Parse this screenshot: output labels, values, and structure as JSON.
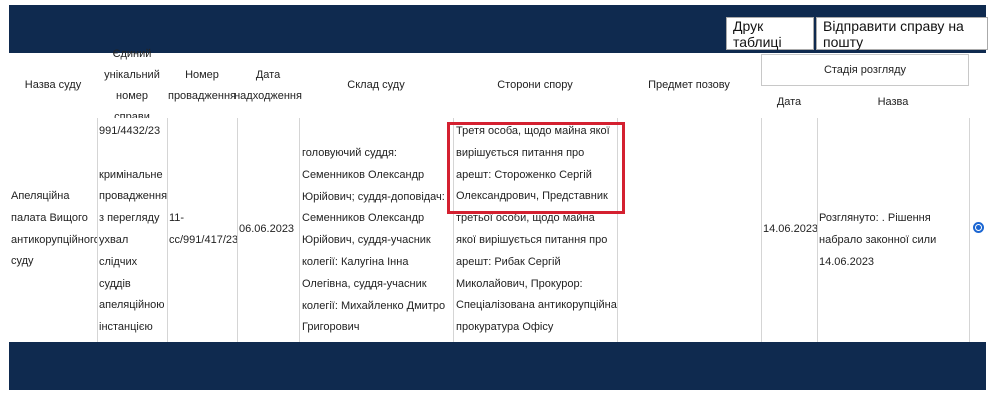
{
  "toolbar": {
    "print_label": "Друк таблиці",
    "mail_label": "Відправити справу на пошту"
  },
  "table": {
    "headers": {
      "court": "Назва суду",
      "unique_number": "Єдиний унікальний номер справи",
      "proceeding_number": "Номер провадження",
      "received_date": "Дата надходження",
      "panel": "Склад суду",
      "parties": "Сторони спору",
      "subject": "Предмет позову",
      "stage": "Стадія розгляду",
      "stage_date": "Дата",
      "stage_name": "Назва"
    },
    "row": {
      "court": "Апеляційна палата Вищого антикорупційного суду",
      "unique_number": "991/4432/23",
      "case_category": "кримінальне провадження з перегляду ухвал слідчих суддів апеляційною інстанцією",
      "proceeding_number": "11-cc/991/417/23",
      "received_date": "06.06.2023",
      "panel": "головуючий суддя: Семенников Олександр Юрійович; суддя-доповідач: Семенников Олександр Юрійович, суддя-учасник колегії: Калугіна Інна Олегівна, суддя-учасник колегії: Михайленко Дмитро Григорович",
      "parties": "Третя особа, щодо майна якої вирішується питання про арешт: Стороженко Сергій Олександрович, Представник третьої особи, щодо майна якої вирішується питання про арешт: Рибак Сергій Миколайович, Прокурор: Спеціалізована антикорупційна прокуратура Офісу Генерального прокурора",
      "subject": "",
      "stage_date": "14.06.2023",
      "stage_name": "Розглянуто: . Рішення набрало законної сили 14.06.2023",
      "selected": true
    }
  },
  "colors": {
    "header_bar": "#0f2a4f",
    "highlight": "#d42030",
    "radio": "#1b66d2"
  }
}
